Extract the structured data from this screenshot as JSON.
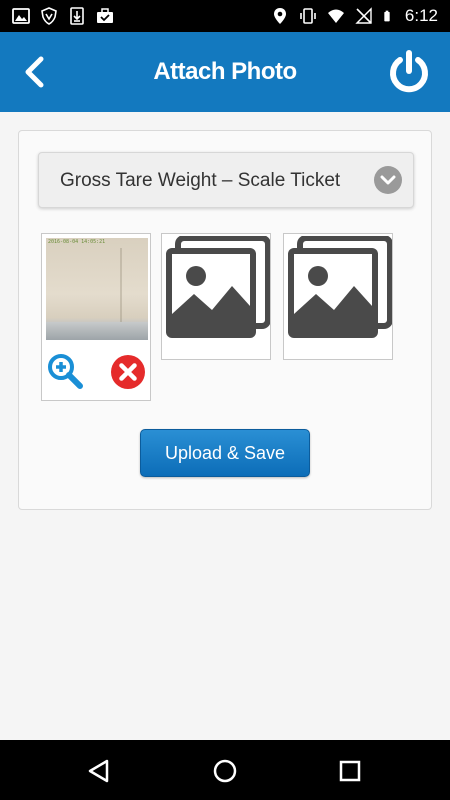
{
  "status_bar": {
    "time": "6:12",
    "left_icons": [
      "image-icon",
      "vpn-shield-icon",
      "download-icon",
      "briefcase-check-icon"
    ],
    "right_icons": [
      "location-icon",
      "vibrate-icon",
      "wifi-icon",
      "no-signal-icon",
      "battery-icon"
    ]
  },
  "app_bar": {
    "title": "Attach Photo",
    "background": "#1379bf"
  },
  "document_type": {
    "selected": "Gross Tare Weight – Scale Ticket"
  },
  "photos": {
    "thumbnails": [
      {
        "state": "captured",
        "stamp": "2016-08-04 14:05:21"
      },
      {
        "state": "empty"
      },
      {
        "state": "empty"
      }
    ]
  },
  "actions": {
    "upload_label": "Upload & Save",
    "accent": "#0c6db8"
  },
  "nav_bar": {
    "buttons": [
      "back-triangle-icon",
      "home-circle-icon",
      "recents-square-icon"
    ]
  }
}
